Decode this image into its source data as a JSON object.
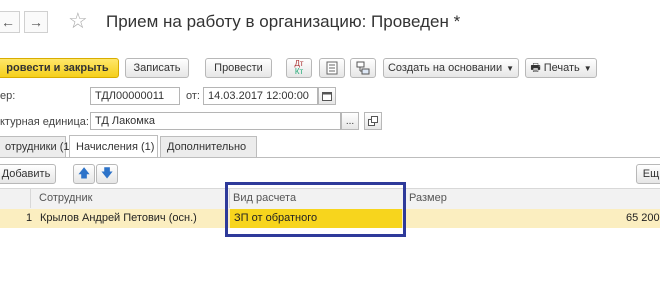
{
  "window": {
    "title": "Прием на работу в организацию: Проведен *"
  },
  "toolbar": {
    "post_close_label": "ровести и закрыть",
    "save_label": "Записать",
    "post_label": "Провести",
    "create_based_label": "Создать на основании",
    "print_label": "Печать"
  },
  "fields": {
    "number_label": "ер:",
    "number_value": "ТДЛ00000011",
    "date_label": "от:",
    "date_value": "14.03.2017 12:00:00",
    "unit_label": "ктурная единица:",
    "unit_value": "ТД Лакомка"
  },
  "tabs": [
    {
      "label": "отрудники (1)"
    },
    {
      "label": "Начисления (1)"
    },
    {
      "label": "Дополнительно"
    }
  ],
  "table_toolbar": {
    "add_label": "Добавить",
    "more_label": "Ещ"
  },
  "table": {
    "columns": [
      "Сотрудник",
      "Вид расчета",
      "Размер"
    ],
    "rows": [
      {
        "n": "1",
        "employee": "Крылов Андрей Петович (осн.)",
        "calc_type": "ЗП от обратного",
        "amount": "65 200,"
      }
    ]
  }
}
